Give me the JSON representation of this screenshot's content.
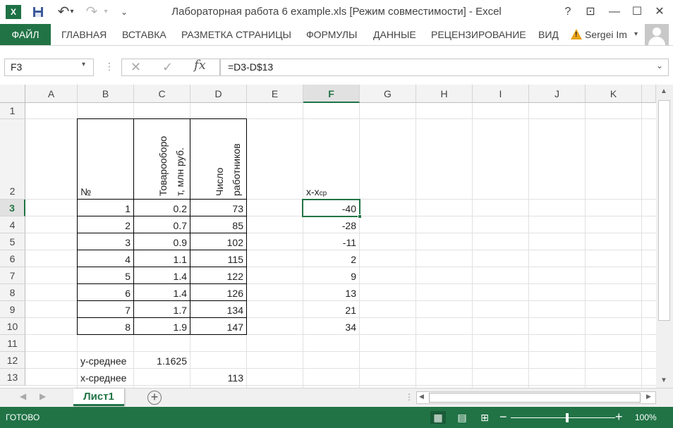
{
  "window": {
    "title": "Лабораторная работа 6 example.xls  [Режим совместимости] - Excel",
    "app_icon": "X",
    "help": "?",
    "restore": "⊡",
    "minimize": "—",
    "maximize": "☐",
    "close": "✕"
  },
  "qat": {
    "save_icon": "💾",
    "undo": "↶",
    "undo_dd": "▾",
    "redo": "↷",
    "redo_dd": "▾",
    "customize": "⌄"
  },
  "ribbon": {
    "file": "ФАЙЛ",
    "tabs": [
      "ГЛАВНАЯ",
      "ВСТАВКА",
      "РАЗМЕТКА СТРАНИЦЫ",
      "ФОРМУЛЫ",
      "ДАННЫЕ",
      "РЕЦЕНЗИРОВАНИЕ",
      "ВИД"
    ],
    "user": "Sergei Im",
    "user_dd": "▾"
  },
  "formula_bar": {
    "name_box": "F3",
    "name_box_dd": "▾",
    "dots": "⋮",
    "cancel": "✕",
    "enter": "✓",
    "fx": "fx",
    "formula": "=D3-D$13",
    "expand": "⌄"
  },
  "columns": [
    "A",
    "B",
    "C",
    "D",
    "E",
    "F",
    "G",
    "H",
    "I",
    "J",
    "K"
  ],
  "rows": [
    "1",
    "2",
    "3",
    "4",
    "5",
    "6",
    "7",
    "8",
    "9",
    "10",
    "11",
    "12",
    "13"
  ],
  "sheet": {
    "b2": "№",
    "c2": "Товарооборот, млн руб.",
    "c2_l1": "Товарооборо",
    "c2_l2": "т, млн руб.",
    "d2_l1": "Число",
    "d2_l2": "работников",
    "f2": "x-x",
    "f2_sub": "ср",
    "table": [
      {
        "n": "1",
        "c": "0.2",
        "d": "73",
        "f": "-40"
      },
      {
        "n": "2",
        "c": "0.7",
        "d": "85",
        "f": "-28"
      },
      {
        "n": "3",
        "c": "0.9",
        "d": "102",
        "f": "-11"
      },
      {
        "n": "4",
        "c": "1.1",
        "d": "115",
        "f": "2"
      },
      {
        "n": "5",
        "c": "1.4",
        "d": "122",
        "f": "9"
      },
      {
        "n": "6",
        "c": "1.4",
        "d": "126",
        "f": "13"
      },
      {
        "n": "7",
        "c": "1.7",
        "d": "134",
        "f": "21"
      },
      {
        "n": "8",
        "c": "1.9",
        "d": "147",
        "f": "34"
      }
    ],
    "b12": "y-среднее",
    "c12": "1.1625",
    "b13": "x-среднее",
    "d13": "113"
  },
  "tabs_bar": {
    "prev": "◀",
    "next": "▶",
    "sheet_name": "Лист1",
    "add": "+",
    "ellipsis": "⋮",
    "scroll_left": "◀",
    "scroll_right": "▶"
  },
  "vscroll": {
    "up": "▲",
    "down": "▼"
  },
  "status": {
    "text": "ГОТОВО",
    "view_normal": "▦",
    "view_layout": "▤",
    "view_break": "⊞",
    "zoom_minus": "−",
    "zoom_plus": "+",
    "zoom": "100%"
  }
}
